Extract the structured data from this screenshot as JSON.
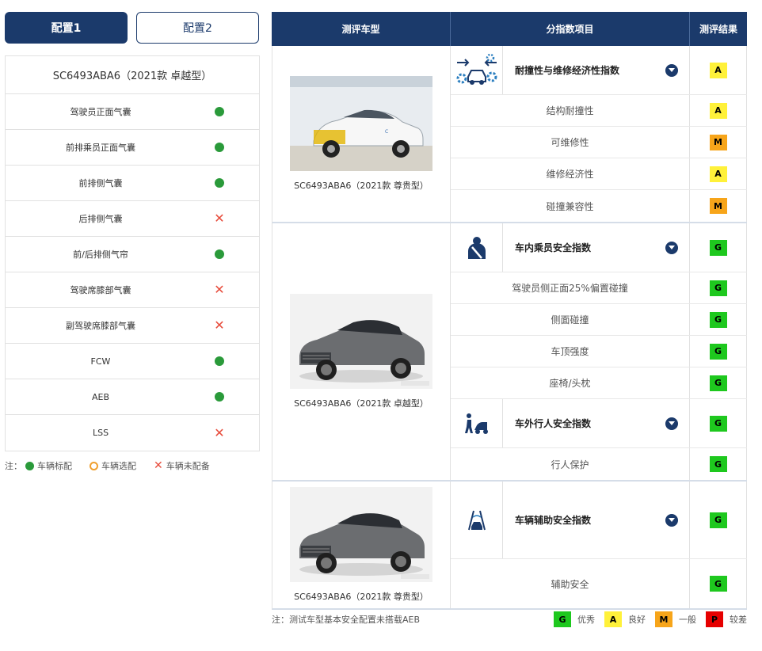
{
  "tabs": [
    {
      "label": "配置1",
      "active": true
    },
    {
      "label": "配置2",
      "active": false
    }
  ],
  "config": {
    "model": "SC6493ABA6（2021款 卓越型）",
    "items": [
      {
        "label": "驾驶员正面气囊",
        "status": "standard"
      },
      {
        "label": "前排乘员正面气囊",
        "status": "standard"
      },
      {
        "label": "前排侧气囊",
        "status": "standard"
      },
      {
        "label": "后排侧气囊",
        "status": "none"
      },
      {
        "label": "前/后排侧气帘",
        "status": "standard"
      },
      {
        "label": "驾驶席膝部气囊",
        "status": "none"
      },
      {
        "label": "副驾驶席膝部气囊",
        "status": "none"
      },
      {
        "label": "FCW",
        "status": "standard"
      },
      {
        "label": "AEB",
        "status": "standard"
      },
      {
        "label": "LSS",
        "status": "none"
      }
    ],
    "legend": {
      "prefix": "注：",
      "standard": "车辆标配",
      "optional": "车辆选配",
      "none": "车辆未配备"
    }
  },
  "results": {
    "headers": {
      "model": "测评车型",
      "item": "分指数项目",
      "result": "测评结果"
    },
    "groups": [
      {
        "car_caption": "SC6493ABA6（2021款 尊贵型）",
        "sections": [
          {
            "title": "耐撞性与维修经济性指数",
            "icon": "crash-repair-icon",
            "grade": "A",
            "subs": [
              {
                "label": "结构耐撞性",
                "grade": "A"
              },
              {
                "label": "可维修性",
                "grade": "M"
              },
              {
                "label": "维修经济性",
                "grade": "A"
              },
              {
                "label": "碰撞兼容性",
                "grade": "M"
              }
            ]
          }
        ]
      },
      {
        "car_caption": "SC6493ABA6（2021款 卓越型）",
        "sections": [
          {
            "title": "车内乘员安全指数",
            "icon": "seatbelt-occupant-icon",
            "grade": "G",
            "subs": [
              {
                "label": "驾驶员侧正面25%偏置碰撞",
                "grade": "G"
              },
              {
                "label": "侧面碰撞",
                "grade": "G"
              },
              {
                "label": "车顶强度",
                "grade": "G"
              },
              {
                "label": "座椅/头枕",
                "grade": "G"
              }
            ]
          },
          {
            "title": "车外行人安全指数",
            "icon": "pedestrian-icon",
            "grade": "G",
            "subs": [
              {
                "label": "行人保护",
                "grade": "G"
              }
            ]
          }
        ]
      },
      {
        "car_caption": "SC6493ABA6（2021款 尊贵型）",
        "sections": [
          {
            "title": "车辆辅助安全指数",
            "icon": "driver-assist-icon",
            "grade": "G",
            "subs": [
              {
                "label": "辅助安全",
                "grade": "G"
              }
            ]
          }
        ]
      }
    ],
    "note": "注：测试车型基本安全配置未搭载AEB",
    "grade_legend": [
      {
        "grade": "G",
        "label": "优秀"
      },
      {
        "grade": "A",
        "label": "良好"
      },
      {
        "grade": "M",
        "label": "一般"
      },
      {
        "grade": "P",
        "label": "较差"
      }
    ]
  },
  "colors": {
    "navy": "#1b3a6b",
    "grade_G": "#1ec81e",
    "grade_A": "#fff13a",
    "grade_M": "#f7a51a",
    "grade_P": "#e60000",
    "standard_dot": "#2a9a3a",
    "none_x": "#e74c3c"
  }
}
